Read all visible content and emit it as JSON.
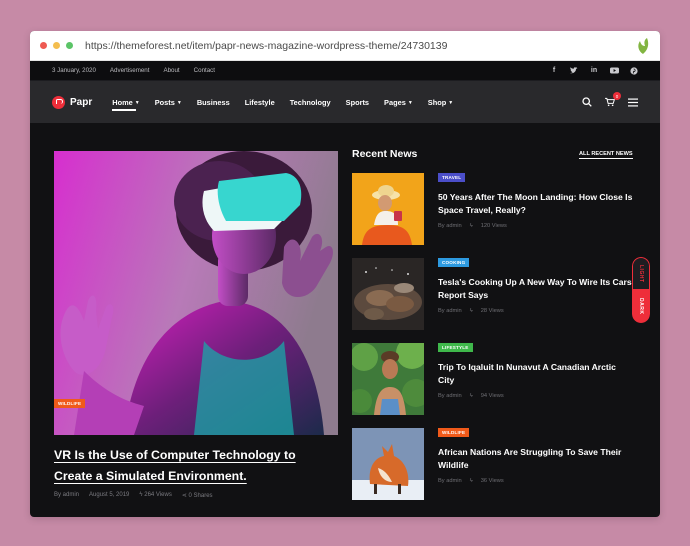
{
  "browser": {
    "url": "https://themeforest.net/item/papr-news-magazine-wordpress-theme/24730139",
    "dot_colors": [
      "#ee5a52",
      "#f4be4f",
      "#5bc467"
    ]
  },
  "topbar": {
    "date": "3 January, 2020",
    "links": [
      "Advertisement",
      "About",
      "Contact"
    ],
    "social_icons": [
      "facebook-icon",
      "twitter-icon",
      "linkedin-icon",
      "youtube-icon",
      "pinterest-icon"
    ]
  },
  "nav": {
    "logo": "Papr",
    "items": [
      {
        "label": "Home",
        "dropdown": true,
        "active": true
      },
      {
        "label": "Posts",
        "dropdown": true
      },
      {
        "label": "Business",
        "dropdown": false
      },
      {
        "label": "Lifestyle",
        "dropdown": false
      },
      {
        "label": "Technology",
        "dropdown": false
      },
      {
        "label": "Sports",
        "dropdown": false
      },
      {
        "label": "Pages",
        "dropdown": true
      },
      {
        "label": "Shop",
        "dropdown": true
      }
    ],
    "cart_count": "0"
  },
  "featured": {
    "tag": "WILDLIFE",
    "title_line1": "VR Is the Use of Computer Technology to",
    "title_line2": "Create a Simulated Environment.",
    "author": "By admin",
    "date": "August 5, 2019",
    "views": "264 Views",
    "shares": "0 Shares"
  },
  "recent": {
    "heading": "Recent News",
    "all_link": "ALL RECENT NEWS",
    "items": [
      {
        "tag": "TRAVEL",
        "tag_color": "#4b4ec9",
        "title": "50 Years After The Moon Landing: How Close Is Space Travel, Really?",
        "author": "By admin",
        "views": "120 Views"
      },
      {
        "tag": "COOKING",
        "tag_color": "#2d9ae0",
        "title": "Tesla's Cooking Up A New Way To Wire Its Cars, Report Says",
        "author": "By admin",
        "views": "28 Views"
      },
      {
        "tag": "LIFESTYLE",
        "tag_color": "#3fb84b",
        "title": "Trip To Iqaluit In Nunavut A Canadian Arctic City",
        "author": "By admin",
        "views": "94 Views"
      },
      {
        "tag": "WILDLIFE",
        "tag_color": "#f05a1a",
        "title": "African Nations Are Struggling To Save Their Wildlife",
        "author": "By admin",
        "views": "36 Views"
      }
    ]
  },
  "mode_toggle": {
    "light": "LIGHT",
    "dark": "DARK"
  }
}
